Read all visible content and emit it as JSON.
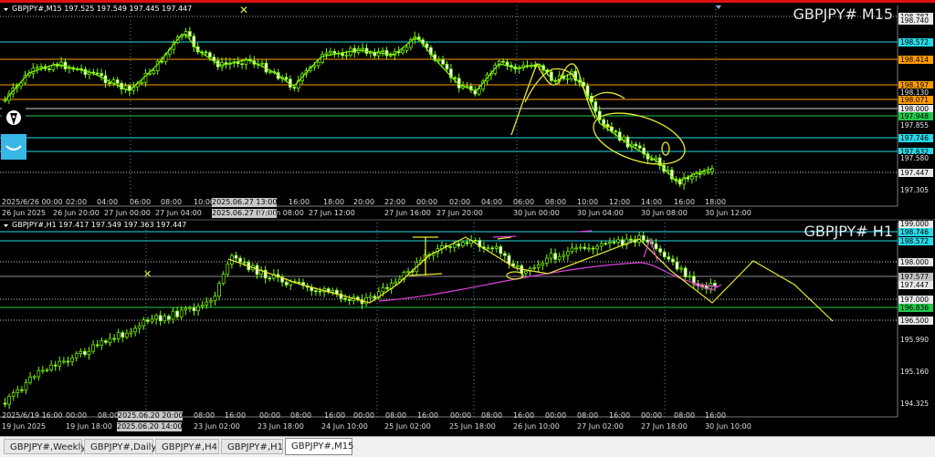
{
  "m15": {
    "info": "GBPJPY#,M15  197.525 197.549 197.445 197.447",
    "label": "GBPJPY# M15",
    "prices": [
      {
        "v": "198.787",
        "bg": "#e8e8e8",
        "fg": "#000"
      },
      {
        "v": "198.740",
        "bg": "#e8e8e8",
        "fg": "#000"
      },
      {
        "v": "198.572",
        "bg": "#27d8e6",
        "fg": "#000"
      },
      {
        "v": "198.414",
        "bg": "#ff9b00",
        "fg": "#000"
      },
      {
        "v": "198.197",
        "bg": "#ff9b00",
        "fg": "#000"
      },
      {
        "v": "198.130",
        "bg": "#000",
        "fg": "#e8e8e8"
      },
      {
        "v": "198.071",
        "bg": "#ff9b00",
        "fg": "#000"
      },
      {
        "v": "198.000",
        "bg": "#e8e8e8",
        "fg": "#000"
      },
      {
        "v": "197.948",
        "bg": "#22c84a",
        "fg": "#000"
      },
      {
        "v": "197.855",
        "bg": "#000",
        "fg": "#e8e8e8"
      },
      {
        "v": "197.746",
        "bg": "#27d8e6",
        "fg": "#000"
      },
      {
        "v": "197.632",
        "bg": "#27d8e6",
        "fg": "#000"
      },
      {
        "v": "197.580",
        "bg": "#000",
        "fg": "#e8e8e8"
      },
      {
        "v": "197.447",
        "bg": "#e8e8e8",
        "fg": "#000"
      },
      {
        "v": "197.305",
        "bg": "#000",
        "fg": "#e8e8e8"
      }
    ],
    "times": [
      "2025/6/26 00:00",
      "02:00",
      "04:00",
      "06:00",
      "08:00",
      "10:00",
      "2025.06.27 13:00",
      "16:00",
      "18:00",
      "20:00",
      "22:00",
      "00:00",
      "02:00",
      "04:00",
      "06:00",
      "08:00",
      "10:00",
      "12:00",
      "14:00",
      "16:00",
      "18:00"
    ],
    "times2": [
      "26 Jun 2025",
      "26 Jun 20:00",
      "27 Jun 00:00",
      "27 Jun 04:00",
      "2025.06.27 07:00",
      "27 Jun 08:00",
      "27 Jun 12:00",
      "27 Jun 16:00",
      "27 Jun 20:00",
      "30 Jun 00:00",
      "30 Jun 04:00",
      "30 Jun 08:00",
      "30 Jun 12:00"
    ]
  },
  "h1": {
    "info": "GBPJPY#,H1  197.417 197.549 197.363 197.447",
    "label": "GBPJPY# H1",
    "prices": [
      {
        "v": "199.000",
        "bg": "#e8e8e8",
        "fg": "#000"
      },
      {
        "v": "198.746",
        "bg": "#27d8e6",
        "fg": "#000"
      },
      {
        "v": "198.572",
        "bg": "#27d8e6",
        "fg": "#000"
      },
      {
        "v": "198.000",
        "bg": "#e8e8e8",
        "fg": "#000"
      },
      {
        "v": "197.577",
        "bg": "#c0c0c0",
        "fg": "#000"
      },
      {
        "v": "197.447",
        "bg": "#e8e8e8",
        "fg": "#000"
      },
      {
        "v": "197.000",
        "bg": "#e8e8e8",
        "fg": "#000"
      },
      {
        "v": "196.836",
        "bg": "#22c84a",
        "fg": "#000"
      },
      {
        "v": "196.500",
        "bg": "#e8e8e8",
        "fg": "#000"
      },
      {
        "v": "195.990",
        "bg": "#000",
        "fg": "#e8e8e8"
      },
      {
        "v": "195.160",
        "bg": "#000",
        "fg": "#e8e8e8"
      },
      {
        "v": "194.325",
        "bg": "#000",
        "fg": "#e8e8e8"
      }
    ],
    "times": [
      "2025/6/19 16:00",
      "00:00",
      "08:00",
      "2025.06.20 20:00",
      "08:00",
      "16:00",
      "00:00",
      "08:00",
      "16:00",
      "00:00",
      "08:00",
      "16:00",
      "00:00",
      "08:00",
      "16:00",
      "00:00",
      "08:00",
      "16:00",
      "00:00",
      "08:00",
      "16:00"
    ],
    "times2": [
      "19 Jun 2025",
      "19 Jun 18:00",
      "2025.06.20 14:00",
      "23 Jun 02:00",
      "23 Jun 18:00",
      "24 Jun 10:00",
      "25 Jun 02:00",
      "25 Jun 18:00",
      "26 Jun 10:00",
      "27 Jun 02:00",
      "27 Jun 18:00",
      "30 Jun 10:00"
    ]
  },
  "tabs": [
    "GBPJPY#,Weekly",
    "GBPJPY#,Daily",
    "GBPJPY#,H4",
    "GBPJPY#,H1",
    "GBPJPY#,M15"
  ],
  "active_tab": "GBPJPY#,M15"
}
